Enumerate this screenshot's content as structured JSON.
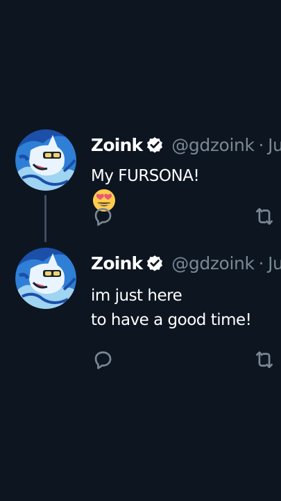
{
  "tweets": [
    {
      "display_name": "Zoink",
      "handle": "@gdzoink",
      "separator": "·",
      "date": "Ju",
      "text_lines": [
        "My FURSONA!"
      ],
      "emoji": "smiling-face-with-heart-eyes"
    },
    {
      "display_name": "Zoink",
      "handle": "@gdzoink",
      "separator": "·",
      "date": "Ju",
      "text_lines": [
        "im just here",
        "to have a good time!"
      ]
    }
  ],
  "colors": {
    "background": "#0d1520",
    "text_primary": "#ffffff",
    "text_secondary": "#7a8893",
    "thread_line": "#3e4e5c",
    "icon": "#7a8893"
  },
  "icons": [
    "avatar",
    "verified-badge-icon",
    "heart-eyes-emoji-icon",
    "reply-icon",
    "retweet-icon"
  ]
}
